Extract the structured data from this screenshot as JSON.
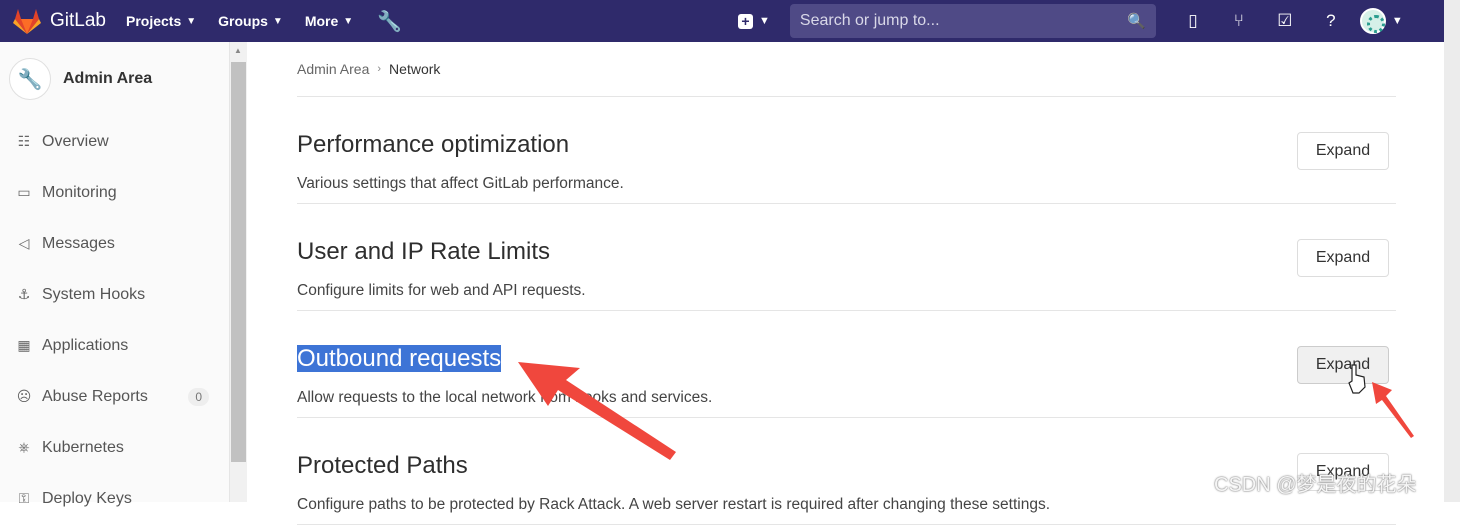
{
  "navbar": {
    "brand": "GitLab",
    "menus": [
      "Projects",
      "Groups",
      "More"
    ],
    "search_placeholder": "Search or jump to...",
    "icons": [
      "plus-icon",
      "issues-icon",
      "merge-requests-icon",
      "todos-icon",
      "help-icon",
      "avatar"
    ]
  },
  "sidebar": {
    "title": "Admin Area",
    "items": [
      {
        "label": "Overview",
        "icon": "overview-icon",
        "glyph": "☷"
      },
      {
        "label": "Monitoring",
        "icon": "monitor-icon",
        "glyph": "▭"
      },
      {
        "label": "Messages",
        "icon": "megaphone-icon",
        "glyph": "◁"
      },
      {
        "label": "System Hooks",
        "icon": "hook-icon",
        "glyph": "⚓"
      },
      {
        "label": "Applications",
        "icon": "apps-icon",
        "glyph": "▦"
      },
      {
        "label": "Abuse Reports",
        "icon": "frown-icon",
        "glyph": "☹",
        "badge": "0"
      },
      {
        "label": "Kubernetes",
        "icon": "kubernetes-icon",
        "glyph": "⎈"
      },
      {
        "label": "Deploy Keys",
        "icon": "key-icon",
        "glyph": "⚿"
      }
    ]
  },
  "breadcrumb": {
    "parent": "Admin Area",
    "current": "Network"
  },
  "sections": [
    {
      "title": "Performance optimization",
      "desc": "Various settings that affect GitLab performance.",
      "button": "Expand"
    },
    {
      "title": "User and IP Rate Limits",
      "desc": "Configure limits for web and API requests.",
      "button": "Expand"
    },
    {
      "title": "Outbound requests",
      "desc": "Allow requests to the local network from hooks and services.",
      "button": "Expand"
    },
    {
      "title": "Protected Paths",
      "desc": "Configure paths to be protected by Rack Attack. A web server restart is required after changing these settings.",
      "button": "Expand"
    }
  ],
  "watermark": "CSDN @梦是夜的花朵",
  "colors": {
    "navbar": "#2f2a6b",
    "highlight": "#3d74d6",
    "annotation_arrow": "#f0473d"
  }
}
